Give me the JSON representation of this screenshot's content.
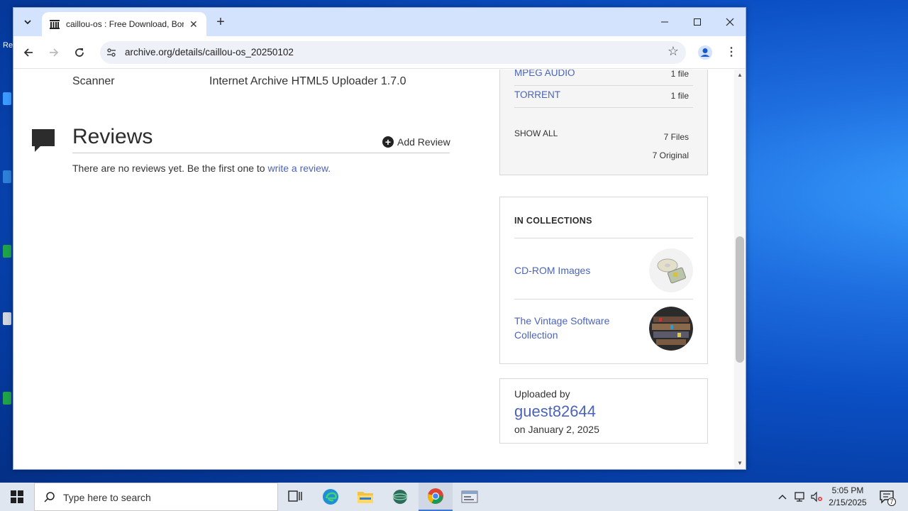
{
  "browser": {
    "tab_title": "caillou-os : Free Download, Borrow, and Streaming : Internet Archive",
    "url": "archive.org/details/caillou-os_20250102",
    "new_tab_symbol": "+",
    "close_symbol": "✕"
  },
  "page": {
    "metadata_key": "Scanner",
    "metadata_value": "Internet Archive HTML5 Uploader 1.7.0",
    "reviews_title": "Reviews",
    "add_review_label": "Add Review",
    "no_reviews_text": "There are no reviews yet. Be the first one to ",
    "write_review_link": "write a review."
  },
  "files": {
    "rows": [
      {
        "name": "MPEG AUDIO",
        "count": "1 file"
      },
      {
        "name": "TORRENT",
        "count": "1 file"
      }
    ],
    "show_all_label": "SHOW ALL",
    "total_files": "7 Files",
    "total_original": "7 Original"
  },
  "collections": {
    "heading": "IN COLLECTIONS",
    "items": [
      {
        "name": "CD-ROM Images",
        "thumb_icon": "cdrom-thumbnail"
      },
      {
        "name": "The Vintage Software Collection",
        "thumb_icon": "vintage-software-thumbnail"
      }
    ]
  },
  "uploader": {
    "label": "Uploaded by",
    "username": "guest82644",
    "date": "on January 2, 2025"
  },
  "taskbar": {
    "search_placeholder": "Type here to search",
    "time": "5:05 PM",
    "date": "2/15/2025",
    "notification_count": "7"
  },
  "colors": {
    "link": "#4b64b9",
    "titlebar": "#d3e3fd",
    "taskbar": "#dfe6ef"
  }
}
